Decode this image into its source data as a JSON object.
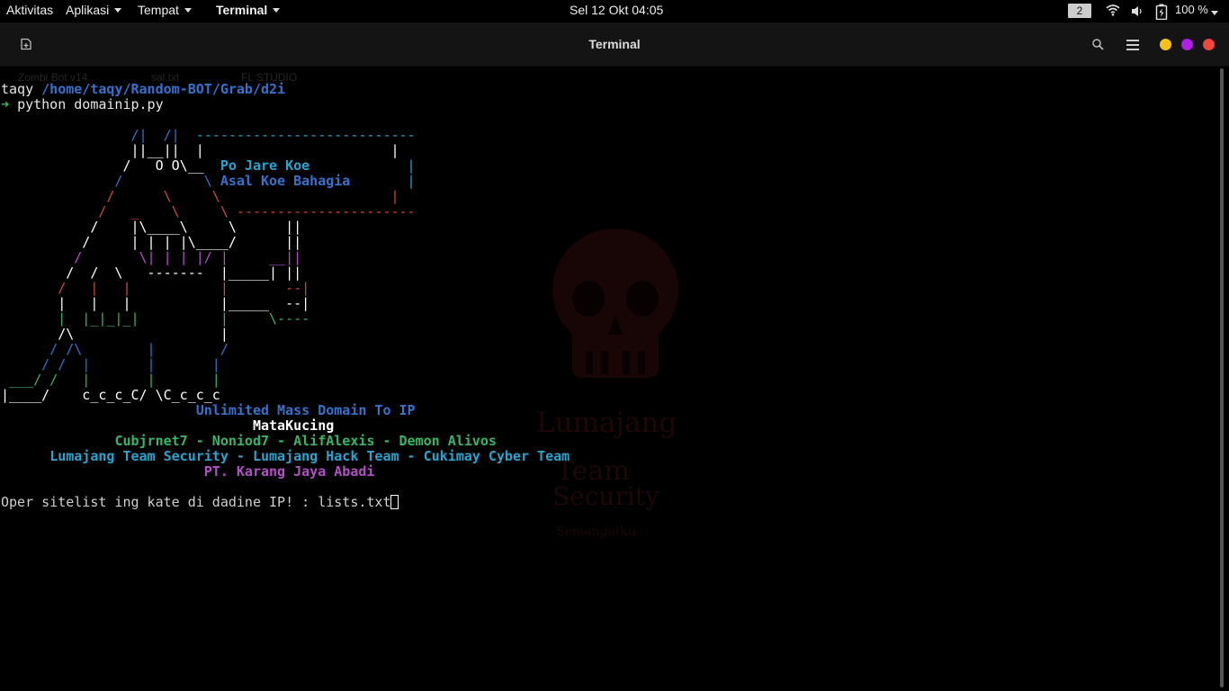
{
  "topbar": {
    "activities": "Aktivitas",
    "applications": "Aplikasi",
    "places": "Tempat",
    "active_app": "Terminal",
    "clock": "Sel 12 Okt  04:05",
    "workspace": "2",
    "battery": "100 %"
  },
  "window": {
    "title": "Terminal",
    "control_colors": {
      "minimize": "#f5c211",
      "maximize": "#b01ee8",
      "close": "#f0463c"
    }
  },
  "background_logo": {
    "line1": "Lumajang",
    "line2": "Team",
    "line3": "Security",
    "line4": "Semangatku"
  },
  "ghost_tabs": [
    "Zombi Bot v14",
    "sal.txt",
    "FL STUDIO"
  ],
  "prompt": {
    "user": "taqy",
    "path": "/home/taqy/Random-BOT/Grab/d2i",
    "arrow": "➜",
    "command": "python domainip.py"
  },
  "banner": {
    "bubble_1": "Po Jare Koe",
    "bubble_2": "Asal Koe Bahagia",
    "title": "Unlimited Mass Domain To IP",
    "author": "MataKucing",
    "credits_1": "Cubjrnet7 - Noniod7 - AlifAlexis - Demon Alivos",
    "credits_2": "Lumajang Team Security - Lumajang Hack Team - Cukimay Cyber Team",
    "company": "PT. Karang Jaya Abadi"
  },
  "input": {
    "question": "Oper sitelist ing kate di dadine IP! : ",
    "value": "lists.txt"
  },
  "colors": {
    "blue": "#3572ce",
    "cyan": "#27a4cf",
    "red": "#d2473c",
    "magenta": "#b54ec9",
    "green": "#35b768"
  }
}
